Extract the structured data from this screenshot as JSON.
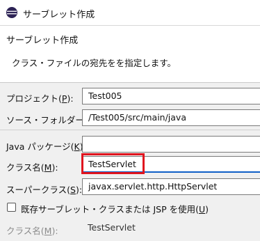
{
  "window": {
    "title": "サーブレット作成",
    "icon": "eclipse-icon"
  },
  "header": {
    "title": "サーブレット作成",
    "description": "クラス・ファイルの宛先をを指定します。"
  },
  "form": {
    "project": {
      "label": "プロジェクト(",
      "mnemonic": "P",
      "label_end": "):",
      "value": "Test005"
    },
    "source_folder": {
      "label": "ソース・フォルダー(",
      "mnemonic": "D",
      "label_end": "):",
      "value": "/Test005/src/main/java"
    },
    "java_package": {
      "label": "Java パッケージ(",
      "mnemonic": "K",
      "label_end": "):",
      "value": ""
    },
    "class_name": {
      "label": "クラス名(",
      "mnemonic": "M",
      "label_end": "):",
      "value": "TestServlet"
    },
    "superclass": {
      "label": "スーパークラス(",
      "mnemonic": "S",
      "label_end": "):",
      "value": "javax.servlet.http.HttpServlet"
    },
    "use_existing": {
      "label": "既存サーブレット・クラスまたは JSP を使用(",
      "mnemonic": "U",
      "label_end": ")",
      "checked": false
    },
    "existing_class_name": {
      "label": "クラス名(",
      "mnemonic": "M",
      "label_end": "):",
      "value": "TestServlet"
    }
  },
  "colors": {
    "highlight": "#e0141e",
    "focus": "#0f5fc7"
  }
}
